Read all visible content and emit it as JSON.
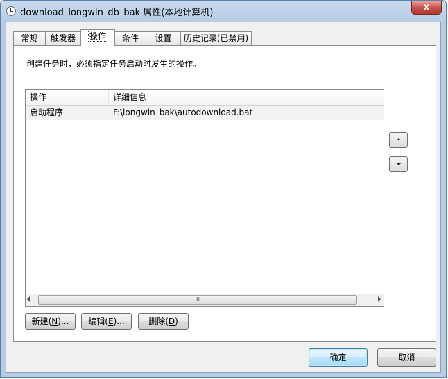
{
  "window": {
    "title": "download_longwin_db_bak 属性(本地计算机)",
    "close_label": "x"
  },
  "tabs": [
    {
      "label": "常规"
    },
    {
      "label": "触发器"
    },
    {
      "label": "操作"
    },
    {
      "label": "条件"
    },
    {
      "label": "设置"
    },
    {
      "label": "历史记录(已禁用)"
    }
  ],
  "active_tab": "操作",
  "panel": {
    "description": "创建任务时，必须指定任务启动时发生的操作。"
  },
  "list": {
    "columns": [
      "操作",
      "详细信息"
    ],
    "rows": [
      {
        "action": "启动程序",
        "details": "F:\\longwin_bak\\autodownload.bat"
      }
    ],
    "scroll_thumb_label": "III"
  },
  "buttons": {
    "new": {
      "label": "新建(",
      "key": "N",
      "suffix": ")..."
    },
    "edit": {
      "label": "编辑(",
      "key": "E",
      "suffix": ")..."
    },
    "delete": {
      "label": "删除(",
      "key": "D",
      "suffix": ")"
    },
    "ok": "确定",
    "cancel": "取消"
  },
  "icons": {
    "title": "clock-icon",
    "move_up": "arrow-up-icon",
    "move_down": "arrow-down-icon"
  }
}
